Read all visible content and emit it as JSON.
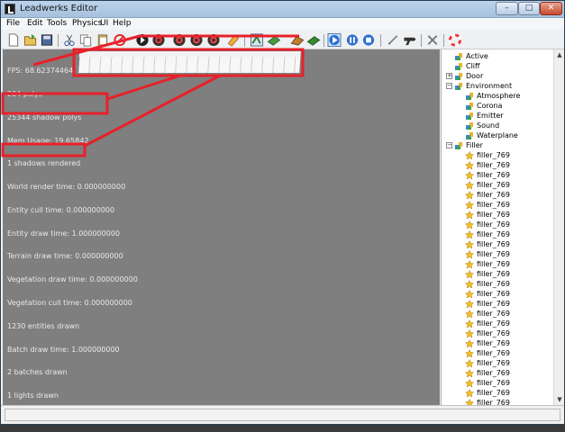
{
  "window": {
    "title": "Leadwerks Editor",
    "controls": {
      "minimize": "–",
      "maximize": "□",
      "close": "✕"
    }
  },
  "menu": {
    "items": [
      "File",
      "Edit",
      "Tools",
      "Physics",
      "UI",
      "Help"
    ]
  },
  "toolbar": {
    "buttons": [
      "new-file-icon",
      "open-file-icon",
      "save-icon",
      "cut-icon",
      "copy-icon",
      "paste-icon",
      "delete-icon",
      "select-tool-icon",
      "move-tool-icon",
      "rotate-icon",
      "scale-icon",
      "terrain-icon",
      "paint-icon",
      "spline-icon",
      "road-icon",
      "vegetation-icon",
      "play-icon",
      "pause-icon",
      "stop-icon",
      "script-icon",
      "gun-icon",
      "tools-icon",
      "help-ring-icon"
    ]
  },
  "viewport": {
    "stats": [
      "FPS: 68.62374464",
      "204 polys",
      "25344 shadow polys",
      "Mem Usage: 19.65842",
      "1 shadows rendered",
      "World render time: 0.000000000",
      "Entity cull time: 0.000000000",
      "Entity draw time: 1.000000000",
      "Terrain draw time: 0.000000000",
      "Vegetation draw time: 0.000000000",
      "Vegetation cull time: 0.000000000",
      "1230 entities drawn",
      "Batch draw time: 1.000000000",
      "2 batches drawn",
      "1 lights drawn"
    ]
  },
  "tree": {
    "nodes": [
      {
        "label": "Active",
        "indent": 1,
        "icon": "entity",
        "expander": ""
      },
      {
        "label": "Cliff",
        "indent": 1,
        "icon": "entity",
        "expander": ""
      },
      {
        "label": "Door",
        "indent": 1,
        "icon": "entity",
        "expander": "+"
      },
      {
        "label": "Environment",
        "indent": 1,
        "icon": "entity",
        "expander": "−"
      },
      {
        "label": "Atmosphere",
        "indent": 2,
        "icon": "entity",
        "expander": ""
      },
      {
        "label": "Corona",
        "indent": 2,
        "icon": "entity",
        "expander": ""
      },
      {
        "label": "Emitter",
        "indent": 2,
        "icon": "entity",
        "expander": ""
      },
      {
        "label": "Sound",
        "indent": 2,
        "icon": "entity",
        "expander": ""
      },
      {
        "label": "Waterplane",
        "indent": 2,
        "icon": "entity",
        "expander": ""
      },
      {
        "label": "Filler",
        "indent": 1,
        "icon": "entity",
        "expander": "−"
      },
      {
        "label": "filler_769",
        "indent": 2,
        "icon": "star",
        "expander": ""
      },
      {
        "label": "filler_769",
        "indent": 2,
        "icon": "star",
        "expander": ""
      },
      {
        "label": "filler_769",
        "indent": 2,
        "icon": "star",
        "expander": ""
      },
      {
        "label": "filler_769",
        "indent": 2,
        "icon": "star",
        "expander": ""
      },
      {
        "label": "filler_769",
        "indent": 2,
        "icon": "star",
        "expander": ""
      },
      {
        "label": "filler_769",
        "indent": 2,
        "icon": "star",
        "expander": ""
      },
      {
        "label": "filler_769",
        "indent": 2,
        "icon": "star",
        "expander": ""
      },
      {
        "label": "filler_769",
        "indent": 2,
        "icon": "star",
        "expander": ""
      },
      {
        "label": "filler_769",
        "indent": 2,
        "icon": "star",
        "expander": ""
      },
      {
        "label": "filler_769",
        "indent": 2,
        "icon": "star",
        "expander": ""
      },
      {
        "label": "filler_769",
        "indent": 2,
        "icon": "star",
        "expander": ""
      },
      {
        "label": "filler_769",
        "indent": 2,
        "icon": "star",
        "expander": ""
      },
      {
        "label": "filler_769",
        "indent": 2,
        "icon": "star",
        "expander": ""
      },
      {
        "label": "filler_769",
        "indent": 2,
        "icon": "star",
        "expander": ""
      },
      {
        "label": "filler_769",
        "indent": 2,
        "icon": "star",
        "expander": ""
      },
      {
        "label": "filler_769",
        "indent": 2,
        "icon": "star",
        "expander": ""
      },
      {
        "label": "filler_769",
        "indent": 2,
        "icon": "star",
        "expander": ""
      },
      {
        "label": "filler_769",
        "indent": 2,
        "icon": "star",
        "expander": ""
      },
      {
        "label": "filler_769",
        "indent": 2,
        "icon": "star",
        "expander": ""
      },
      {
        "label": "filler_769",
        "indent": 2,
        "icon": "star",
        "expander": ""
      },
      {
        "label": "filler_769",
        "indent": 2,
        "icon": "star",
        "expander": ""
      },
      {
        "label": "filler_769",
        "indent": 2,
        "icon": "star",
        "expander": ""
      },
      {
        "label": "filler_769",
        "indent": 2,
        "icon": "star",
        "expander": ""
      },
      {
        "label": "filler_769",
        "indent": 2,
        "icon": "star",
        "expander": ""
      },
      {
        "label": "filler_769",
        "indent": 2,
        "icon": "star",
        "expander": ""
      },
      {
        "label": "filler_769",
        "indent": 2,
        "icon": "star",
        "expander": ""
      }
    ],
    "scroll": {
      "up": "▲",
      "down": "▼"
    }
  },
  "colors": {
    "annotation": "#e8202a",
    "viewport": "#7f7f7f",
    "stats_text": "#e9e9e9",
    "accent": "#2a6fd0"
  }
}
